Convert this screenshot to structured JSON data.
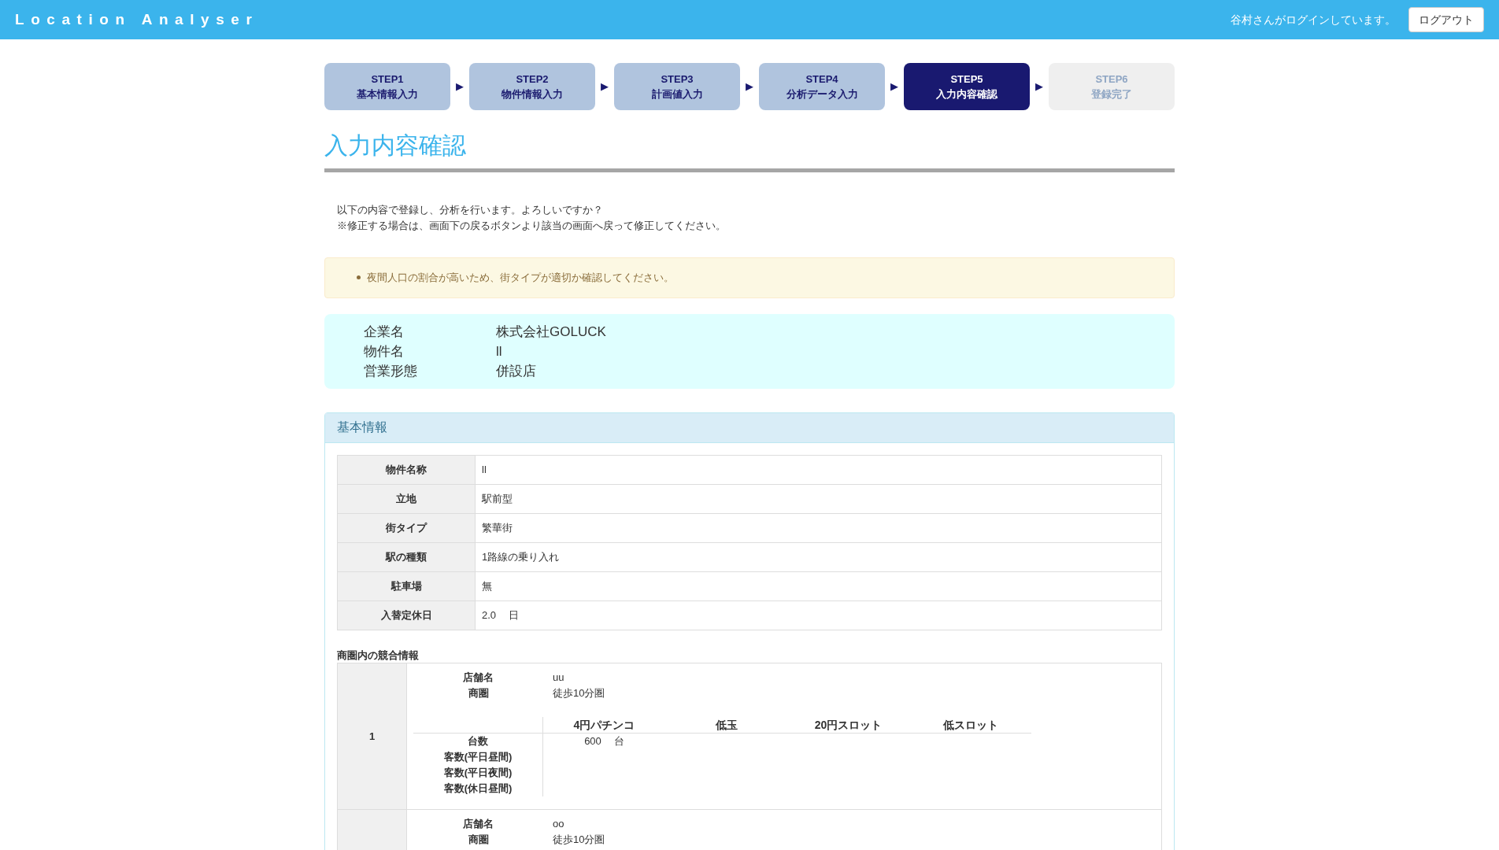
{
  "header": {
    "title": "Location Analyser",
    "user_text": "谷村さんがログインしています。",
    "logout": "ログアウト"
  },
  "steps": [
    {
      "step": "STEP1",
      "label": "基本情報入力",
      "selected": false,
      "disabled": false
    },
    {
      "step": "STEP2",
      "label": "物件情報入力",
      "selected": false,
      "disabled": false
    },
    {
      "step": "STEP3",
      "label": "計画値入力",
      "selected": false,
      "disabled": false
    },
    {
      "step": "STEP4",
      "label": "分析データ入力",
      "selected": false,
      "disabled": false
    },
    {
      "step": "STEP5",
      "label": "入力内容確認",
      "selected": true,
      "disabled": false
    },
    {
      "step": "STEP6",
      "label": "登録完了",
      "selected": false,
      "disabled": true
    }
  ],
  "step_arrow": "▶",
  "page_title": "入力内容確認",
  "intro": [
    "以下の内容で登録し、分析を行います。よろしいですか？",
    "※修正する場合は、画面下の戻るボタンより該当の画面へ戻って修正してください。"
  ],
  "alerts": [
    "夜間人口の割合が高いため、街タイプが適切か確認してください。"
  ],
  "summary": [
    {
      "label": "企業名",
      "value": "株式会社GOLUCK"
    },
    {
      "label": "物件名",
      "value": "ll"
    },
    {
      "label": "営業形態",
      "value": "併設店"
    }
  ],
  "panel": {
    "title": "基本情報",
    "rows": [
      {
        "label": "物件名称",
        "value": "ll"
      },
      {
        "label": "立地",
        "value": "駅前型"
      },
      {
        "label": "街タイプ",
        "value": "繁華街"
      },
      {
        "label": "駅の種類",
        "value": "1路線の乗り入れ"
      },
      {
        "label": "駐車場",
        "value": "無"
      },
      {
        "label": "入替定休日",
        "value": "2.0",
        "unit": "日"
      }
    ],
    "competition": {
      "title": "商圏内の競合情報",
      "stores": [
        {
          "index": "1",
          "fields": [
            {
              "label": "店舗名",
              "value": "uu"
            },
            {
              "label": "商圏",
              "value": "徒歩10分圏"
            }
          ],
          "machines": {
            "columns": [
              "4円パチンコ",
              "低玉",
              "20円スロット",
              "低スロット"
            ],
            "rows": [
              {
                "label": "台数",
                "cells": [
                  {
                    "value": "600",
                    "unit": "台"
                  }
                ]
              },
              {
                "label": "客数(平日昼間)",
                "cells": []
              },
              {
                "label": "客数(平日夜間)",
                "cells": []
              },
              {
                "label": "客数(休日昼間)",
                "cells": []
              }
            ]
          }
        },
        {
          "fields": [
            {
              "label": "店舗名",
              "value": "oo"
            },
            {
              "label": "商圏",
              "value": "徒歩10分圏"
            }
          ]
        }
      ]
    }
  }
}
